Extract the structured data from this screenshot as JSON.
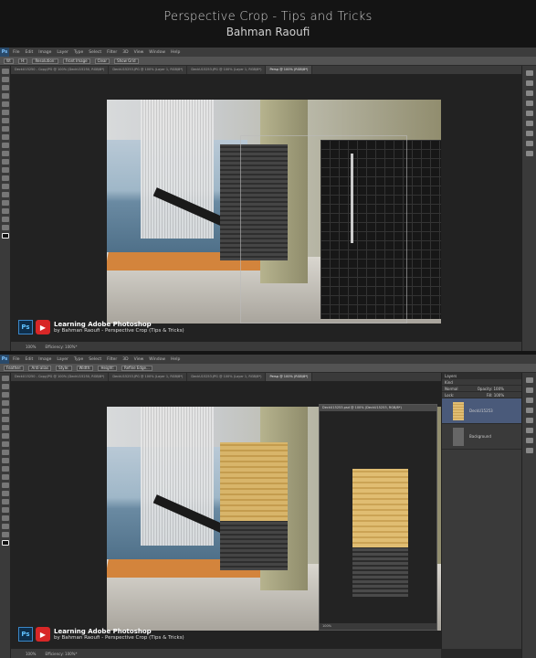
{
  "header": {
    "title": "Perspective Crop - Tips and Tricks",
    "author": "Bahman Raoufi"
  },
  "app": {
    "logo": "Ps",
    "menu": [
      "File",
      "Edit",
      "Image",
      "Layer",
      "Type",
      "Select",
      "Filter",
      "3D",
      "View",
      "Window",
      "Help"
    ]
  },
  "screen1": {
    "options": [
      "W:",
      "H:",
      "Resolution:",
      "Front Image",
      "Clear",
      "Show Grid"
    ],
    "tabs": [
      "DeckU15250 - Copy.JPG @ 100% (DeckU15250, RGB/8*)",
      "DeckU15253.JPG @ 100% (Layer 1, RGB/8*)",
      "DeckU15253.JPG @ 100% (Layer 1, RGB/8*)",
      "Persp @ 100% (RGB/8*)"
    ],
    "status": {
      "zoom": "100%",
      "efficiency": "Efficiency: 100%*"
    }
  },
  "screen2": {
    "options": [
      "Feather:",
      "Anti-alias",
      "Style:",
      "Width:",
      "Height:",
      "Refine Edge..."
    ],
    "tabs": [
      "DeckU15250 - Copy.JPG @ 100% (DeckU15250, RGB/8*)",
      "DeckU15253.JPG @ 100% (Layer 1, RGB/8*)",
      "DeckU15253.JPG @ 100% (Layer 1, RGB/8*)",
      "Persp @ 100% (RGB/8*)"
    ],
    "subwindow": {
      "title": "DeckU15253.psd @ 100% (DeckU15253, RGB/8*)",
      "status": "100%"
    },
    "status": {
      "zoom": "100%",
      "efficiency": "Efficiency: 100%*"
    },
    "layers": {
      "panel_title": "Layers",
      "kind": "Kind",
      "blend": "Normal",
      "opacity": "Opacity: 100%",
      "lock": "Lock:",
      "fill": "Fill: 100%",
      "items": [
        {
          "name": "DeckU15253"
        },
        {
          "name": "Background"
        }
      ]
    }
  },
  "watermark": {
    "badge": "Ps",
    "title": "Learning Adobe Photoshop",
    "subtitle": "by Bahman Raoufi - Perspective Crop (Tips & Tricks)"
  },
  "colors": {
    "ps_bg": "#282828",
    "accent": "#d82727",
    "ps_blue": "#5fc1ff"
  }
}
